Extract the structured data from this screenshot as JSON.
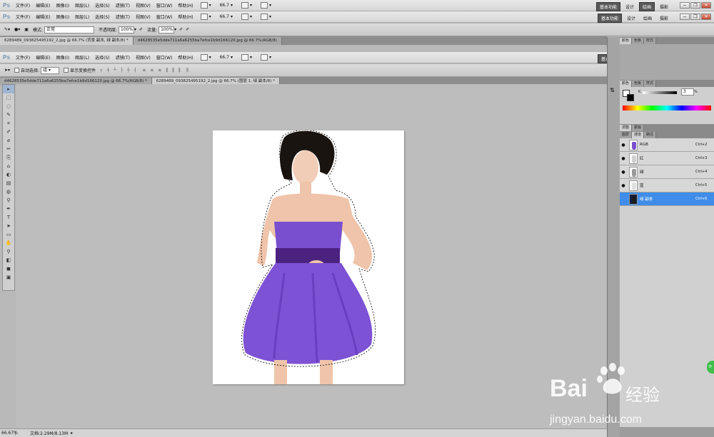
{
  "app": {
    "logo": "Ps",
    "menus": [
      "文件(F)",
      "编辑(E)",
      "图像(I)",
      "图层(L)",
      "选择(S)",
      "滤镜(T)",
      "视图(V)",
      "窗口(W)",
      "帮助(H)"
    ],
    "zoom_value": "66.7",
    "workspaces": [
      "基本功能",
      "设计",
      "绘画",
      "摄影"
    ],
    "active_workspace": "基本功能",
    "win_buttons": [
      "−",
      "❐",
      "✕"
    ]
  },
  "options_brush": {
    "mode_label": "模式:",
    "mode_value": "正常",
    "opacity_label": "不透明度:",
    "opacity_value": "100%",
    "flow_label": "流量:",
    "flow_value": "100%"
  },
  "doc_tabs_1": [
    {
      "label": "6289489_093825495192_2.jpg @ 66.7% (背景 副本, 绿 副本/8) *",
      "active": true
    },
    {
      "label": "d4628535e5dde711a6a6255ba7efce1b9d166120.jpg @ 66.7%(RGB/8)",
      "active": false
    }
  ],
  "options_move": {
    "auto_select_label": "自动选择:",
    "auto_select_value": "组",
    "show_transform_label": "显示变换控件"
  },
  "doc_tabs_2": [
    {
      "label": "d4628535e5dde711a6a6255ba7efce1b9d166120.jpg @ 66.7%(RGB/8) *",
      "active": false
    },
    {
      "label": "6289489_093825495192_2.jpg @ 66.7% (图层 1, 绿 副本/8) *",
      "active": true
    }
  ],
  "tools": [
    "▸",
    "⬚",
    "◌",
    "✎",
    "⌗",
    "✐",
    "⌀",
    "✏",
    "⎘",
    "⌂",
    "◐",
    "▤",
    "◍",
    "⚲",
    "✒",
    "T",
    "➤",
    "▭",
    "✋",
    "⚲",
    "◧",
    "◼",
    "▣"
  ],
  "status": {
    "zoom": "66.67%",
    "doc": "文档:2.29M/8.13M"
  },
  "color_panel": {
    "tabs": [
      "颜色",
      "色板",
      "样式"
    ],
    "k_label": "K",
    "k_value": "3",
    "k_unit": "%"
  },
  "adjust_panel": {
    "tabs": [
      "调整",
      "蒙版"
    ]
  },
  "channels_panel": {
    "tabs": [
      "图层",
      "通道",
      "路径"
    ],
    "active_tab": "通道",
    "rows": [
      {
        "name": "RGB",
        "shortcut": "Ctrl+2",
        "visible": true,
        "selected": false
      },
      {
        "name": "红",
        "shortcut": "Ctrl+3",
        "visible": true,
        "selected": false
      },
      {
        "name": "绿",
        "shortcut": "Ctrl+4",
        "visible": true,
        "selected": false
      },
      {
        "name": "蓝",
        "shortcut": "Ctrl+5",
        "visible": true,
        "selected": false
      },
      {
        "name": "绿 副本",
        "shortcut": "Ctrl+6",
        "visible": false,
        "selected": true
      }
    ]
  },
  "watermark": {
    "brand_latin": "Bai",
    "brand_cn": "经验",
    "url": "jingyan.baidu.com"
  },
  "colors": {
    "selection_blue": "#3f8de8",
    "dress_purple": "#7a4fcf"
  }
}
